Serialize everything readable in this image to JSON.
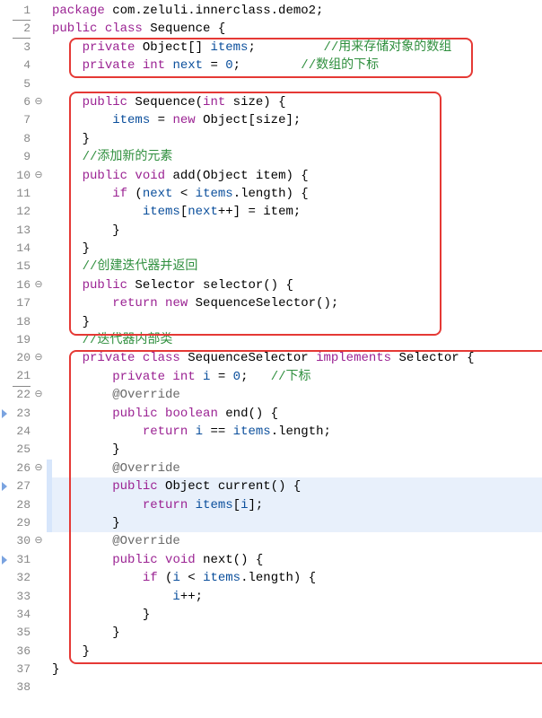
{
  "gutter": [
    {
      "n": "1",
      "u": true,
      "fold": "",
      "tri": false
    },
    {
      "n": "2",
      "u": true,
      "fold": "",
      "tri": false
    },
    {
      "n": "3",
      "u": false,
      "fold": "",
      "tri": false
    },
    {
      "n": "4",
      "u": false,
      "fold": "",
      "tri": false
    },
    {
      "n": "5",
      "u": false,
      "fold": "",
      "tri": false
    },
    {
      "n": "6",
      "u": false,
      "fold": "⊖",
      "tri": false
    },
    {
      "n": "7",
      "u": false,
      "fold": "",
      "tri": false
    },
    {
      "n": "8",
      "u": false,
      "fold": "",
      "tri": false
    },
    {
      "n": "9",
      "u": false,
      "fold": "",
      "tri": false
    },
    {
      "n": "10",
      "u": false,
      "fold": "⊖",
      "tri": false
    },
    {
      "n": "11",
      "u": false,
      "fold": "",
      "tri": false
    },
    {
      "n": "12",
      "u": false,
      "fold": "",
      "tri": false
    },
    {
      "n": "13",
      "u": false,
      "fold": "",
      "tri": false
    },
    {
      "n": "14",
      "u": false,
      "fold": "",
      "tri": false
    },
    {
      "n": "15",
      "u": false,
      "fold": "",
      "tri": false
    },
    {
      "n": "16",
      "u": false,
      "fold": "⊖",
      "tri": false
    },
    {
      "n": "17",
      "u": false,
      "fold": "",
      "tri": false
    },
    {
      "n": "18",
      "u": false,
      "fold": "",
      "tri": false
    },
    {
      "n": "19",
      "u": false,
      "fold": "",
      "tri": false
    },
    {
      "n": "20",
      "u": false,
      "fold": "⊖",
      "tri": false
    },
    {
      "n": "21",
      "u": true,
      "fold": "",
      "tri": false
    },
    {
      "n": "22",
      "u": false,
      "fold": "⊖",
      "tri": false
    },
    {
      "n": "23",
      "u": false,
      "fold": "",
      "tri": true
    },
    {
      "n": "24",
      "u": false,
      "fold": "",
      "tri": false
    },
    {
      "n": "25",
      "u": false,
      "fold": "",
      "tri": false
    },
    {
      "n": "26",
      "u": false,
      "fold": "⊖",
      "tri": false
    },
    {
      "n": "27",
      "u": false,
      "fold": "",
      "tri": true
    },
    {
      "n": "28",
      "u": false,
      "fold": "",
      "tri": false
    },
    {
      "n": "29",
      "u": false,
      "fold": "",
      "tri": false
    },
    {
      "n": "30",
      "u": false,
      "fold": "⊖",
      "tri": false
    },
    {
      "n": "31",
      "u": false,
      "fold": "",
      "tri": true
    },
    {
      "n": "32",
      "u": false,
      "fold": "",
      "tri": false
    },
    {
      "n": "33",
      "u": false,
      "fold": "",
      "tri": false
    },
    {
      "n": "34",
      "u": false,
      "fold": "",
      "tri": false
    },
    {
      "n": "35",
      "u": false,
      "fold": "",
      "tri": false
    },
    {
      "n": "36",
      "u": false,
      "fold": "",
      "tri": false
    },
    {
      "n": "37",
      "u": false,
      "fold": "",
      "tri": false
    },
    {
      "n": "38",
      "u": false,
      "fold": "",
      "tri": false
    }
  ],
  "code": {
    "l1": {
      "kw1": "package",
      "pkg": " com.zeluli.innerclass.demo2;"
    },
    "l2": {
      "kw1": "public",
      "kw2": "class",
      "name": " Sequence ",
      "br": "{"
    },
    "l3": {
      "indent": "    ",
      "kw1": "private",
      "type": " Object[] ",
      "field": "items",
      "semi": ";",
      "pad": "         ",
      "com": "//用来存储对象的数组"
    },
    "l4": {
      "indent": "    ",
      "kw1": "private",
      "kw2": " int ",
      "field": "next",
      "eq": " = ",
      "num": "0",
      "semi": ";",
      "pad": "        ",
      "com": "//数组的下标"
    },
    "l5": "",
    "l6": {
      "indent": "    ",
      "kw1": "public",
      "name": " Sequence(",
      "kw2": "int",
      "param": " size) {"
    },
    "l7": {
      "indent": "        ",
      "field": "items",
      "eq": " = ",
      "kw1": "new",
      "rest": " Object[size];"
    },
    "l8": {
      "indent": "    ",
      "br": "}"
    },
    "l9": {
      "indent": "    ",
      "com": "//添加新的元素"
    },
    "l10": {
      "indent": "    ",
      "kw1": "public",
      "kw2": " void ",
      "name": "add(Object item) {"
    },
    "l11": {
      "indent": "        ",
      "kw1": "if",
      "rest": " (",
      "field1": "next",
      "mid": " < ",
      "field2": "items",
      "end": ".length) {"
    },
    "l12": {
      "indent": "            ",
      "field1": "items",
      "b1": "[",
      "field2": "next",
      "rest": "++] = item;"
    },
    "l13": {
      "indent": "        ",
      "br": "}"
    },
    "l14": {
      "indent": "    ",
      "br": "}"
    },
    "l15": {
      "indent": "    ",
      "com": "//创建迭代器并返回"
    },
    "l16": {
      "indent": "    ",
      "kw1": "public",
      "type": " Selector ",
      "name": "selector() {"
    },
    "l17": {
      "indent": "        ",
      "kw1": "return",
      "kw2": " new ",
      "rest": "SequenceSelector();"
    },
    "l18": {
      "indent": "    ",
      "br": "}"
    },
    "l19": {
      "indent": "    ",
      "com": "//迭代器内部类"
    },
    "l20": {
      "indent": "    ",
      "kw1": "private",
      "kw2": " class ",
      "name": "SequenceSelector ",
      "kw3": "implements",
      "rest": " Selector {"
    },
    "l21": {
      "indent": "        ",
      "kw1": "private",
      "kw2": " int ",
      "field": "i",
      "eq": " = ",
      "num": "0",
      "semi": ";",
      "pad": "   ",
      "com": "//下标"
    },
    "l22": {
      "indent": "        ",
      "ann": "@Override"
    },
    "l23": {
      "indent": "        ",
      "kw1": "public",
      "kw2": " boolean ",
      "name": "end() {"
    },
    "l24": {
      "indent": "            ",
      "kw1": "return",
      "sp": " ",
      "field1": "i",
      "mid": " == ",
      "field2": "items",
      "end": ".length;"
    },
    "l25": {
      "indent": "        ",
      "br": "}"
    },
    "l26": {
      "indent": "        ",
      "ann": "@Override"
    },
    "l27": {
      "indent": "        ",
      "kw1": "public",
      "type": " Object ",
      "name": "current() {"
    },
    "l28": {
      "indent": "            ",
      "kw1": "return",
      "sp": " ",
      "field1": "items",
      "b1": "[",
      "field2": "i",
      "end": "];"
    },
    "l29": {
      "indent": "        ",
      "br": "}"
    },
    "l30": {
      "indent": "        ",
      "ann": "@Override"
    },
    "l31": {
      "indent": "        ",
      "kw1": "public",
      "kw2": " void ",
      "name": "next() {"
    },
    "l32": {
      "indent": "            ",
      "kw1": "if",
      "rest": " (",
      "field1": "i",
      "mid": " < ",
      "field2": "items",
      "end": ".length) {"
    },
    "l33": {
      "indent": "                ",
      "field": "i",
      "rest": "++;"
    },
    "l34": {
      "indent": "            ",
      "br": "}"
    },
    "l35": {
      "indent": "        ",
      "br": "}"
    },
    "l36": {
      "indent": "    ",
      "br": "}"
    },
    "l37": {
      "br": "}"
    },
    "l38": ""
  }
}
